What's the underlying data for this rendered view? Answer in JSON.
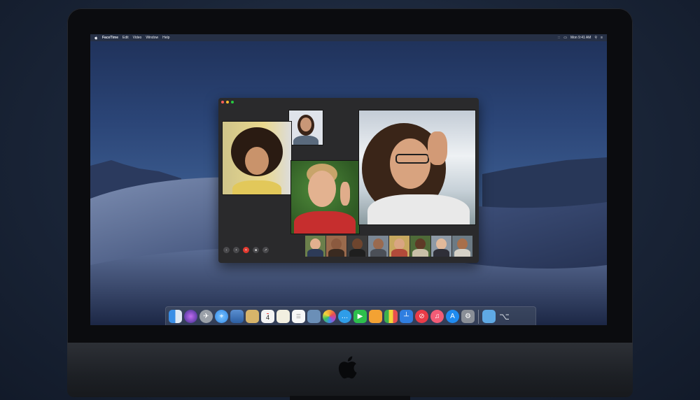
{
  "menubar": {
    "app_name": "FaceTime",
    "items": [
      "Edit",
      "Video",
      "Window",
      "Help"
    ],
    "clock": "Mon 9:41 AM"
  },
  "dock": {
    "calendar_day": "4",
    "icons": [
      {
        "name": "finder-icon",
        "color": "#3a8ee6"
      },
      {
        "name": "siri-icon",
        "color": "#8a5cd6"
      },
      {
        "name": "launchpad-icon",
        "color": "#9aa0a8"
      },
      {
        "name": "safari-icon",
        "color": "#2f87e8"
      },
      {
        "name": "photo-booth-icon",
        "color": "#c23a3a"
      },
      {
        "name": "notes-icon",
        "color": "#d7b46a"
      },
      {
        "name": "calendar-icon",
        "color": "#f3f3f3"
      },
      {
        "name": "stickies-icon",
        "color": "#f2efe0"
      },
      {
        "name": "reminders-icon",
        "color": "#f7f7f7"
      },
      {
        "name": "preview-icon",
        "color": "#6b8fb7"
      },
      {
        "name": "photos-icon",
        "color": "#f1a63b"
      },
      {
        "name": "messages-icon",
        "color": "#42c35a"
      },
      {
        "name": "facetime-icon",
        "color": "#2dbf4c"
      },
      {
        "name": "pages-icon",
        "color": "#f3a233"
      },
      {
        "name": "numbers-icon",
        "color": "#3cb04d"
      },
      {
        "name": "keynote-icon",
        "color": "#2f7ee0"
      },
      {
        "name": "news-icon",
        "color": "#ea3b47"
      },
      {
        "name": "music-icon",
        "color": "#f25c76"
      },
      {
        "name": "app-store-icon",
        "color": "#1f8bf0"
      },
      {
        "name": "system-preferences-icon",
        "color": "#8a8f97"
      },
      {
        "name": "downloads-folder-icon",
        "color": "#5fa9e4"
      },
      {
        "name": "trash-icon",
        "color": "#9aa2ad"
      }
    ]
  },
  "colors": {
    "close": "#ff5f57",
    "minimize": "#febc2e",
    "zoom": "#28c840",
    "end_call": "#e1382e"
  }
}
